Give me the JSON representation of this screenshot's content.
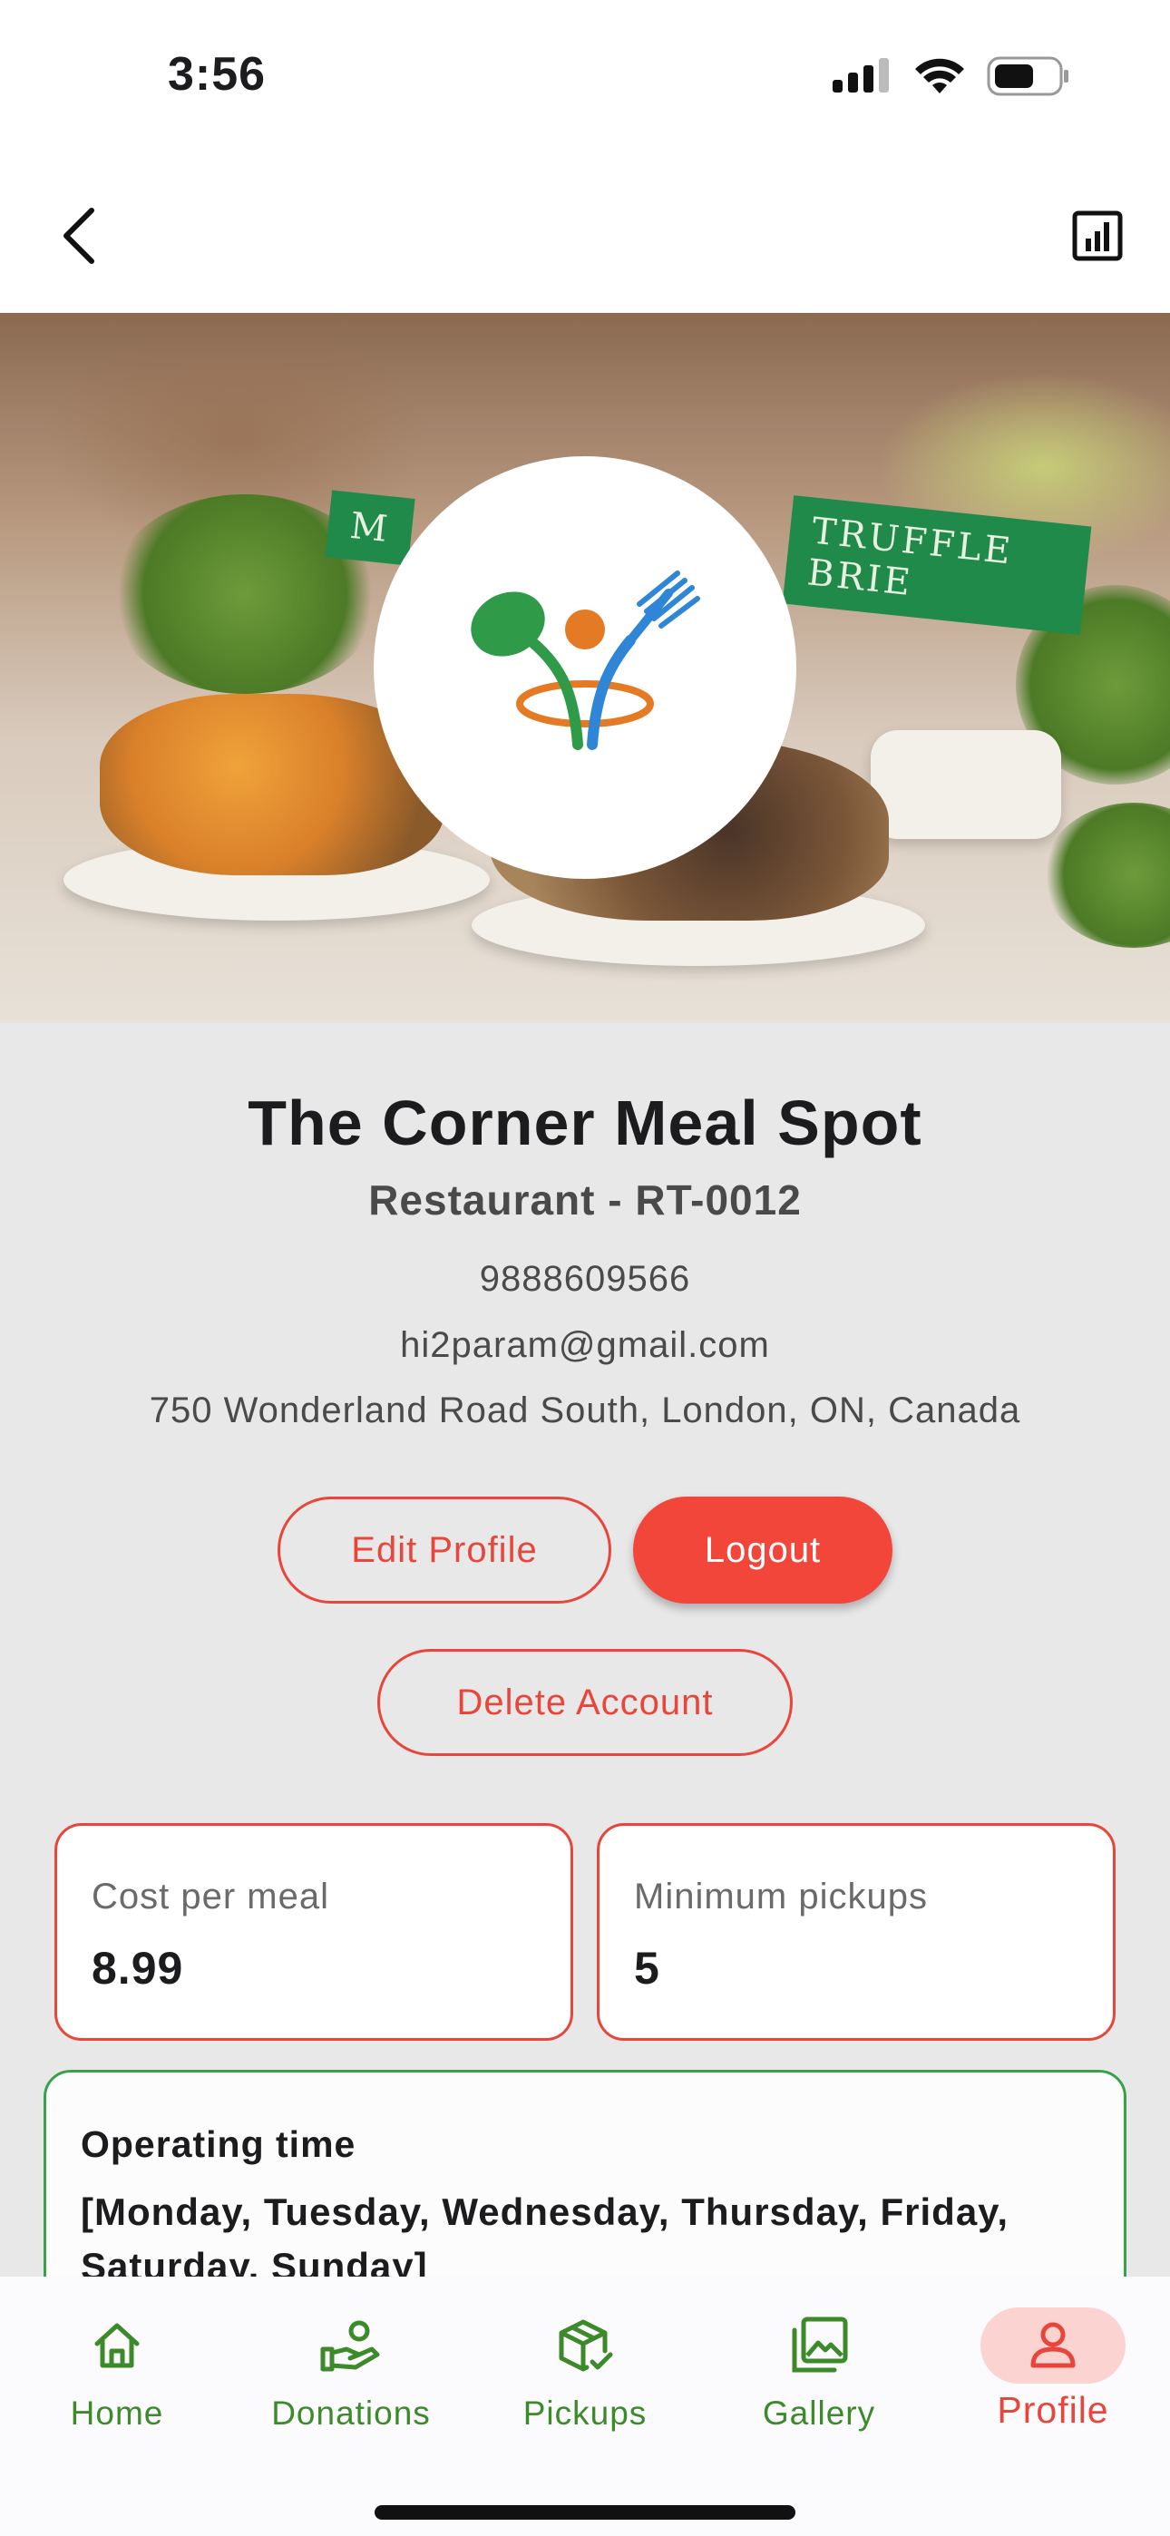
{
  "status_bar": {
    "time": "3:56",
    "icons": [
      "signal-icon",
      "wifi-icon",
      "battery-icon"
    ]
  },
  "top_nav": {
    "back_icon": "chevron-left-icon",
    "stats_icon": "bar-chart-icon"
  },
  "hero": {
    "flags": [
      "M",
      "TRUFFLE BRIE"
    ],
    "logo": "food-rescue-logo-icon"
  },
  "profile": {
    "name": "The Corner Meal Spot",
    "subtitle": "Restaurant - RT-0012",
    "phone": "9888609566",
    "email": "hi2param@gmail.com",
    "address": "750 Wonderland Road South, London, ON, Canada"
  },
  "actions": {
    "edit_label": "Edit Profile",
    "logout_label": "Logout",
    "delete_label": "Delete Account"
  },
  "stats": {
    "cost_label": "Cost per meal",
    "cost_value": "8.99",
    "min_label": "Minimum pickups",
    "min_value": "5"
  },
  "operating": {
    "title": "Operating time",
    "days": "[Monday, Tuesday, Wednesday, Thursday, Friday, Saturday, Sunday]"
  },
  "tabs": [
    {
      "label": "Home",
      "icon": "home-icon",
      "active": false
    },
    {
      "label": "Donations",
      "icon": "donation-hand-icon",
      "active": false
    },
    {
      "label": "Pickups",
      "icon": "package-check-icon",
      "active": false
    },
    {
      "label": "Gallery",
      "icon": "gallery-icon",
      "active": false
    },
    {
      "label": "Profile",
      "icon": "person-icon",
      "active": true
    }
  ],
  "colors": {
    "accent_red": "#e8463a",
    "accent_green": "#3d8a2a",
    "content_bg": "#e9e8e9"
  }
}
